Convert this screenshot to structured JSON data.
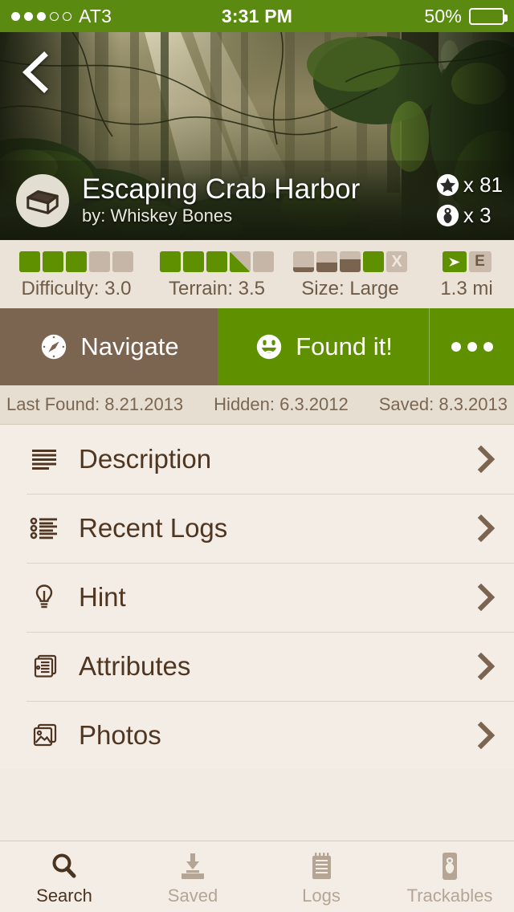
{
  "status_bar": {
    "carrier": "AT3",
    "time": "3:31 PM",
    "battery_pct": "50%",
    "signal_dots_filled": 3,
    "signal_dots_total": 5
  },
  "hero": {
    "back_icon": "chevron-left-icon",
    "image_alt": "misty forest with sun rays"
  },
  "cache": {
    "type_icon": "ammo-box-icon",
    "title": "Escaping Crab Harbor",
    "owner": "by: Whiskey Bones",
    "favorites": {
      "icon": "star-icon",
      "text": "x 81"
    },
    "trackables": {
      "icon": "trackable-icon",
      "text": "x 3"
    }
  },
  "stats": {
    "difficulty": {
      "label": "Difficulty: 3.0",
      "value": 3.0,
      "max": 5
    },
    "terrain": {
      "label": "Terrain: 3.5",
      "value": 3.5,
      "max": 5
    },
    "size": {
      "label": "Size: Large",
      "selected_index": 3,
      "boxes": 5
    },
    "distance": {
      "label": "1.3 mi",
      "direction_icon": "arrow-right-icon",
      "direction_letter": "E"
    }
  },
  "actions": {
    "navigate": {
      "label": "Navigate",
      "icon": "compass-icon",
      "color": "#7b6450"
    },
    "found": {
      "label": "Found it!",
      "icon": "smiley-icon",
      "color": "#5f9000"
    },
    "more": {
      "label": "",
      "icon": "ellipsis-icon"
    }
  },
  "dates": {
    "last_found": "Last Found: 8.21.2013",
    "hidden": "Hidden: 6.3.2012",
    "saved": "Saved: 8.3.2013"
  },
  "menu": [
    {
      "label": "Description",
      "icon": "text-lines-icon"
    },
    {
      "label": "Recent Logs",
      "icon": "bullet-list-icon"
    },
    {
      "label": "Hint",
      "icon": "lightbulb-icon"
    },
    {
      "label": "Attributes",
      "icon": "pages-icon"
    },
    {
      "label": "Photos",
      "icon": "photos-icon"
    }
  ],
  "tabs": [
    {
      "label": "Search",
      "icon": "magnifier-icon",
      "active": true
    },
    {
      "label": "Saved",
      "icon": "download-tray-icon",
      "active": false
    },
    {
      "label": "Logs",
      "icon": "notepad-icon",
      "active": false
    },
    {
      "label": "Trackables",
      "icon": "trackable-tag-icon",
      "active": false
    }
  ],
  "colors": {
    "green": "#5f9000",
    "brown": "#7b6450",
    "cream": "#f4ede6",
    "tan": "#ece3d8",
    "dark_brown": "#4e3622"
  }
}
